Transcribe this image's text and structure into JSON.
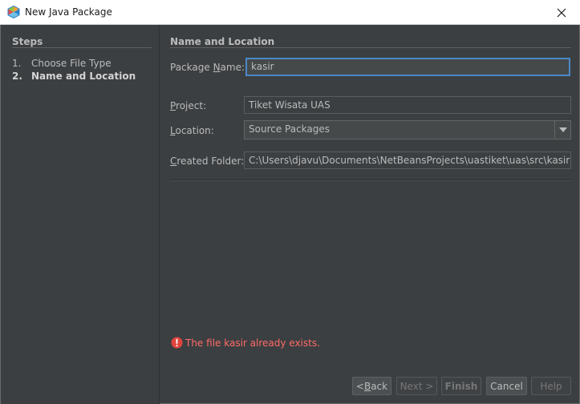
{
  "window": {
    "title": "New Java Package",
    "icon": "netbeans-cube-icon",
    "close_icon": "close-icon"
  },
  "steps": {
    "heading": "Steps",
    "items": [
      {
        "number": "1.",
        "label": "Choose File Type",
        "current": false
      },
      {
        "number": "2.",
        "label": "Name and Location",
        "current": true
      }
    ]
  },
  "form": {
    "heading": "Name and Location",
    "package_name": {
      "label_pre": "Package ",
      "label_mnemonic": "N",
      "label_post": "ame:",
      "value": "kasir"
    },
    "project": {
      "label_pre": "",
      "label_mnemonic": "P",
      "label_post": "roject:",
      "value": "Tiket Wisata UAS"
    },
    "location": {
      "label_pre": "",
      "label_mnemonic": "L",
      "label_post": "ocation:",
      "value": "Source Packages"
    },
    "created_folder": {
      "label_pre": "",
      "label_mnemonic": "C",
      "label_post": "reated Folder:",
      "value": "C:\\Users\\djavu\\Documents\\NetBeansProjects\\uastiket\\uas\\src\\kasir"
    }
  },
  "error": {
    "icon": "error-icon",
    "message": "The file kasir already exists."
  },
  "buttons": {
    "back": {
      "pre": "< ",
      "mnemonic": "B",
      "post": "ack"
    },
    "next": "Next >",
    "finish": "Finish",
    "cancel": "Cancel",
    "help": "Help"
  },
  "colors": {
    "background": "#3c3f41",
    "text": "#bbbbbb",
    "error": "#ff6b68",
    "focus": "#4a88c7"
  }
}
